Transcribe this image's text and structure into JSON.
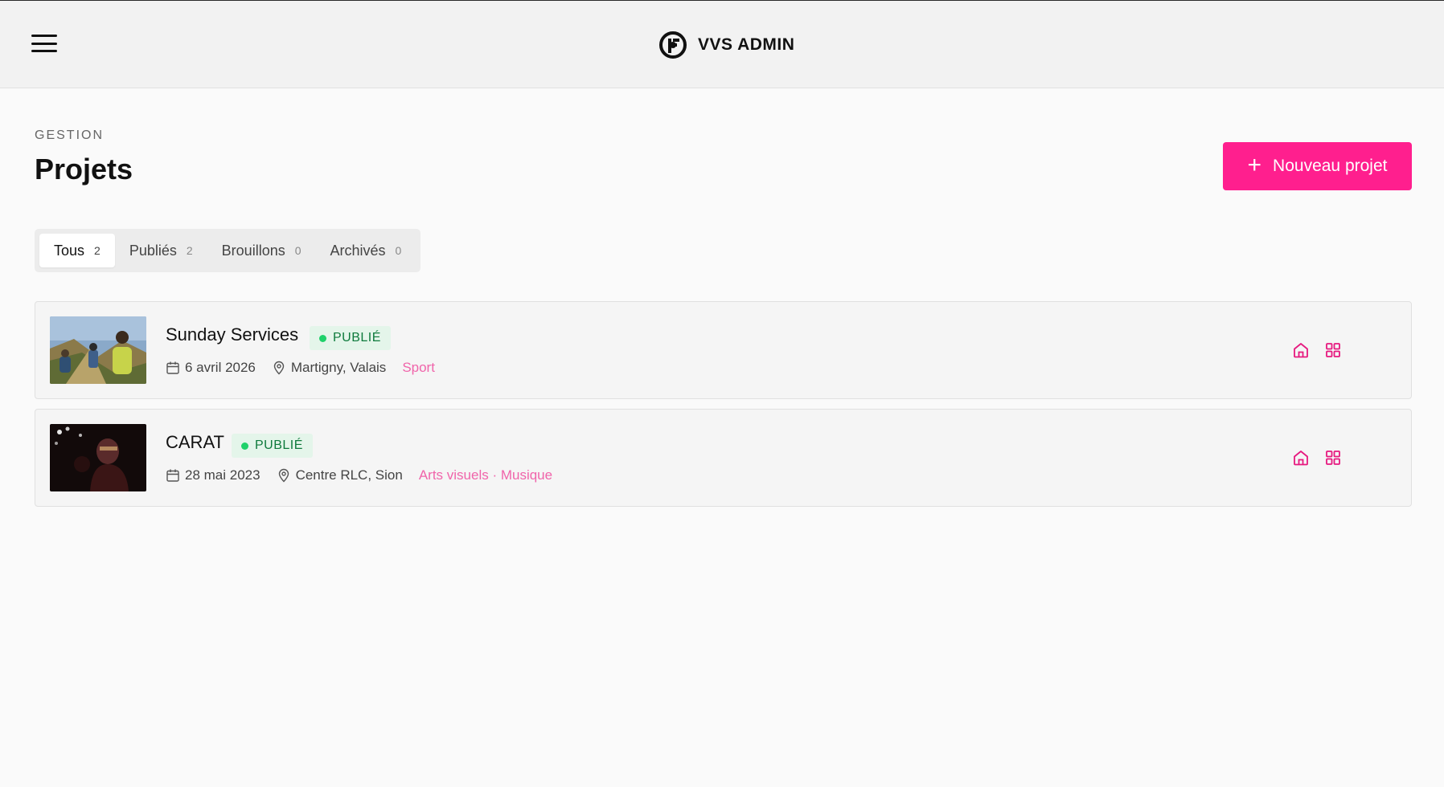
{
  "header": {
    "title": "VVS ADMIN",
    "menu_icon": "hamburger-icon",
    "logo_icon": "vvs-logo-icon"
  },
  "page": {
    "section_label": "GESTION",
    "title": "Projets",
    "new_button_label": "Nouveau projet"
  },
  "tabs": [
    {
      "label": "Tous",
      "count": "2",
      "active": true
    },
    {
      "label": "Publiés",
      "count": "2",
      "active": false
    },
    {
      "label": "Brouillons",
      "count": "0",
      "active": false
    },
    {
      "label": "Archivés",
      "count": "0",
      "active": false
    }
  ],
  "projects": [
    {
      "name": "Sunday Services",
      "status": "PUBLIÉ",
      "date": "6 avril 2026",
      "location": "Martigny, Valais",
      "tags": "Sport"
    },
    {
      "name": "CARAT",
      "status": "PUBLIÉ",
      "date": "28 mai 2023",
      "location": "Centre RLC, Sion",
      "tags": "Arts visuels · Musique"
    }
  ],
  "colors": {
    "accent": "#ff1f8e",
    "status_bg": "#e4f5ea",
    "status_text": "#0e7a3c",
    "status_dot": "#1fd16a",
    "tag_text": "#f064aa"
  }
}
